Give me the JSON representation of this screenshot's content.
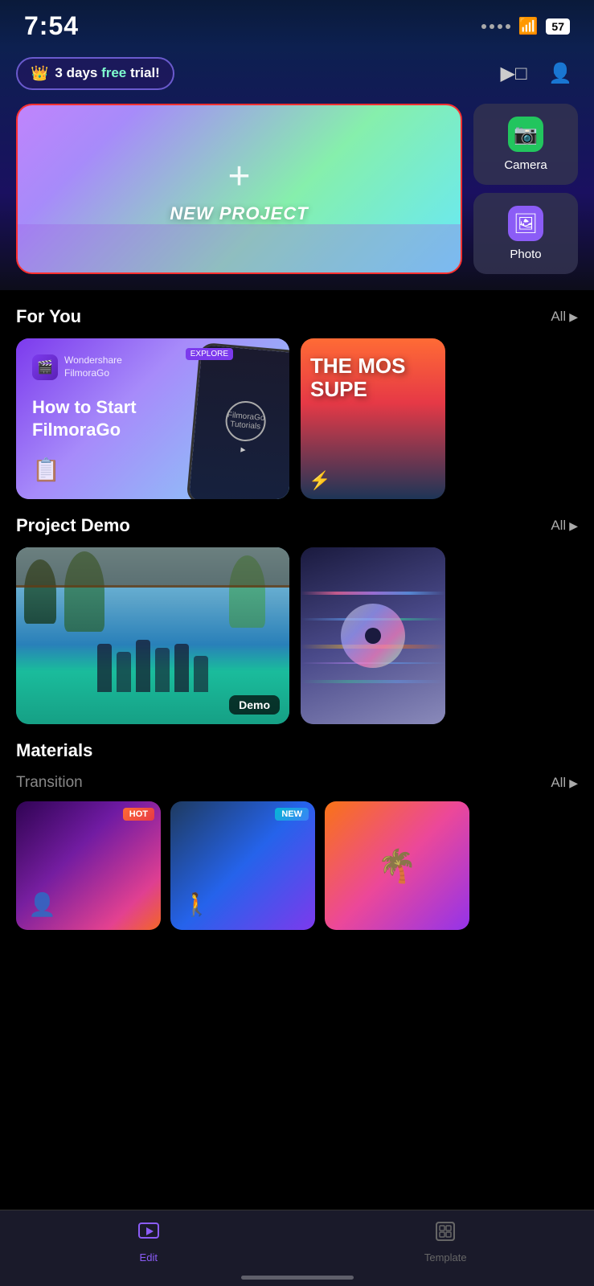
{
  "status": {
    "time": "7:54",
    "battery": "57",
    "wifi": true
  },
  "header": {
    "trial_text": "3 days free trial!",
    "trial_highlight": "free",
    "crown": "👑"
  },
  "new_project": {
    "label": "NEW PROJECT",
    "plus": "+"
  },
  "side_buttons": {
    "camera": {
      "label": "Camera",
      "icon": "📷"
    },
    "photo": {
      "label": "Photo",
      "icon": "🖼"
    }
  },
  "for_you": {
    "section_title": "For You",
    "all_label": "All",
    "tutorial_card": {
      "logo_text1": "Wondershare",
      "logo_text2": "FilmoraGo",
      "title_line1": "How to Start",
      "title_line2": "FilmoraGo",
      "phone_text": "FilmoraGo Tutorials",
      "explore_label": "EXPLORE"
    },
    "super_card": {
      "text1": "THE MOS",
      "text2": "SUPE"
    }
  },
  "project_demo": {
    "section_title": "Project Demo",
    "all_label": "All",
    "demo_badge": "Demo"
  },
  "materials": {
    "section_title": "Materials",
    "transition_title": "Transition",
    "all_label": "All",
    "hot_badge": "HOT",
    "new_badge": "NEW"
  },
  "nav": {
    "edit_label": "Edit",
    "template_label": "Template"
  }
}
